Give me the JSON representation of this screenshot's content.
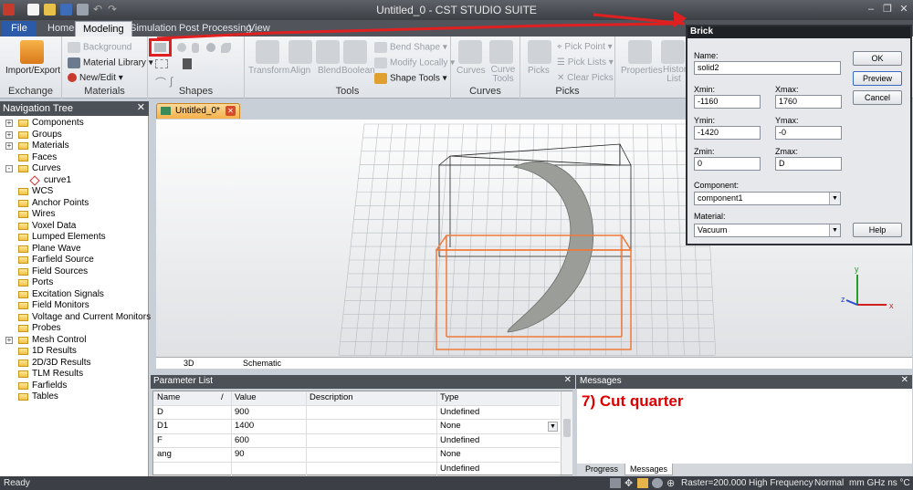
{
  "window": {
    "title": "Untitled_0 - CST STUDIO SUITE"
  },
  "tabs": [
    "File",
    "Home",
    "Modeling",
    "Simulation",
    "Post Processing",
    "View"
  ],
  "ribbon": {
    "exchange": {
      "label": "Exchange",
      "import_export": "Import/Export"
    },
    "materials": {
      "label": "Materials",
      "background": "Background",
      "material_library": "Material Library",
      "new_edit": "New/Edit"
    },
    "shapes": {
      "label": "Shapes"
    },
    "tools": {
      "label": "Tools",
      "transform": "Transform",
      "align": "Align",
      "blend": "Blend",
      "boolean": "Boolean",
      "bend_shape": "Bend Shape",
      "modify_locally": "Modify Locally",
      "shape_tools": "Shape Tools"
    },
    "curves": {
      "label": "Curves",
      "curves": "Curves",
      "curve_tools": "Curve Tools"
    },
    "picks": {
      "label": "Picks",
      "picks": "Picks",
      "pick_point": "Pick Point",
      "pick_lists": "Pick Lists",
      "clear_picks": "Clear Picks"
    },
    "properties": "Properties",
    "history_list": "History List"
  },
  "nav": {
    "title": "Navigation Tree",
    "items": [
      {
        "label": "Components",
        "exp": "+"
      },
      {
        "label": "Groups",
        "exp": "+"
      },
      {
        "label": "Materials",
        "exp": "+"
      },
      {
        "label": "Faces",
        "exp": ""
      },
      {
        "label": "Curves",
        "exp": "-"
      },
      {
        "label": "curve1",
        "exp": "",
        "child": true
      },
      {
        "label": "WCS",
        "exp": ""
      },
      {
        "label": "Anchor Points",
        "exp": ""
      },
      {
        "label": "Wires",
        "exp": ""
      },
      {
        "label": "Voxel Data",
        "exp": ""
      },
      {
        "label": "Lumped Elements",
        "exp": ""
      },
      {
        "label": "Plane Wave",
        "exp": ""
      },
      {
        "label": "Farfield Source",
        "exp": ""
      },
      {
        "label": "Field Sources",
        "exp": ""
      },
      {
        "label": "Ports",
        "exp": ""
      },
      {
        "label": "Excitation Signals",
        "exp": ""
      },
      {
        "label": "Field Monitors",
        "exp": ""
      },
      {
        "label": "Voltage and Current Monitors",
        "exp": ""
      },
      {
        "label": "Probes",
        "exp": ""
      },
      {
        "label": "Mesh Control",
        "exp": "+"
      },
      {
        "label": "1D Results",
        "exp": ""
      },
      {
        "label": "2D/3D Results",
        "exp": ""
      },
      {
        "label": "TLM Results",
        "exp": ""
      },
      {
        "label": "Farfields",
        "exp": ""
      },
      {
        "label": "Tables",
        "exp": ""
      }
    ]
  },
  "document": {
    "tab": "Untitled_0*",
    "view_tabs": [
      "3D",
      "Schematic"
    ],
    "axes": {
      "x": "x",
      "y": "y",
      "z": "z"
    }
  },
  "parameters": {
    "title": "Parameter List",
    "headers": [
      "Name",
      "Value",
      "Description",
      "Type"
    ],
    "rows": [
      [
        "D",
        "900",
        "",
        "Undefined"
      ],
      [
        "D1",
        "1400",
        "",
        "None"
      ],
      [
        "F",
        "600",
        "",
        "Undefined"
      ],
      [
        "ang",
        "90",
        "",
        "None"
      ],
      [
        "",
        "",
        "",
        "Undefined"
      ]
    ]
  },
  "messages": {
    "title": "Messages",
    "text": "7) Cut quarter",
    "tabs": [
      "Progress",
      "Messages"
    ]
  },
  "status": {
    "ready": "Ready",
    "raster": "Raster=200.000",
    "solver": "High Frequency",
    "mode": "Normal",
    "units": "mm GHz ns °C"
  },
  "dialog": {
    "title": "Brick",
    "name_label": "Name:",
    "name": "solid2",
    "xmin_label": "Xmin:",
    "xmin": "-1160",
    "xmax_label": "Xmax:",
    "xmax": "1760",
    "ymin_label": "Ymin:",
    "ymin": "-1420",
    "ymax_label": "Ymax:",
    "ymax": "-0",
    "zmin_label": "Zmin:",
    "zmin": "0",
    "zmax_label": "Zmax:",
    "zmax": "D",
    "component_label": "Component:",
    "component": "component1",
    "material_label": "Material:",
    "material": "Vacuum",
    "ok": "OK",
    "preview": "Preview",
    "cancel": "Cancel",
    "help": "Help"
  },
  "colors": {
    "accent": "#2a5aa8",
    "highlight": "#e02020",
    "selection": "#f07a3a"
  }
}
